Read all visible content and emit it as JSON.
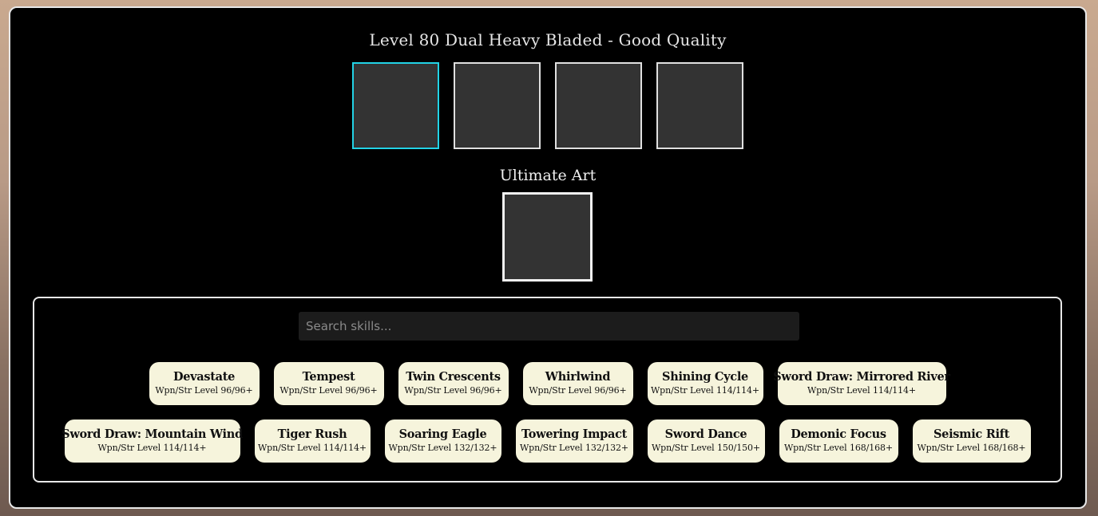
{
  "header": {
    "title": "Level 80 Dual Heavy Bladed - Good Quality"
  },
  "slots": [
    {
      "id": "slot-1",
      "active": true
    },
    {
      "id": "slot-2",
      "active": false
    },
    {
      "id": "slot-3",
      "active": false
    },
    {
      "id": "slot-4",
      "active": false
    }
  ],
  "ultimate": {
    "label": "Ultimate Art"
  },
  "search": {
    "placeholder": "Search skills..."
  },
  "colors": {
    "active_slot_border": "#22d3e6",
    "skill_card_bg": "#f6f4dc",
    "panel_bg": "#000000",
    "slot_bg": "#333333"
  },
  "skills_row1": [
    {
      "name": "Devastate",
      "req": "Wpn/Str Level 96/96+"
    },
    {
      "name": "Tempest",
      "req": "Wpn/Str Level 96/96+"
    },
    {
      "name": "Twin Crescents",
      "req": "Wpn/Str Level 96/96+"
    },
    {
      "name": "Whirlwind",
      "req": "Wpn/Str Level 96/96+"
    },
    {
      "name": "Shining Cycle",
      "req": "Wpn/Str Level 114/114+"
    },
    {
      "name": "Sword Draw: Mirrored River",
      "req": "Wpn/Str Level 114/114+"
    }
  ],
  "skills_row2": [
    {
      "name": "Sword Draw: Mountain Wind",
      "req": "Wpn/Str Level 114/114+"
    },
    {
      "name": "Tiger Rush",
      "req": "Wpn/Str Level 114/114+"
    },
    {
      "name": "Soaring Eagle",
      "req": "Wpn/Str Level 132/132+"
    },
    {
      "name": "Towering Impact",
      "req": "Wpn/Str Level 132/132+"
    },
    {
      "name": "Sword Dance",
      "req": "Wpn/Str Level 150/150+"
    },
    {
      "name": "Demonic Focus",
      "req": "Wpn/Str Level 168/168+"
    },
    {
      "name": "Seismic Rift",
      "req": "Wpn/Str Level 168/168+"
    }
  ]
}
